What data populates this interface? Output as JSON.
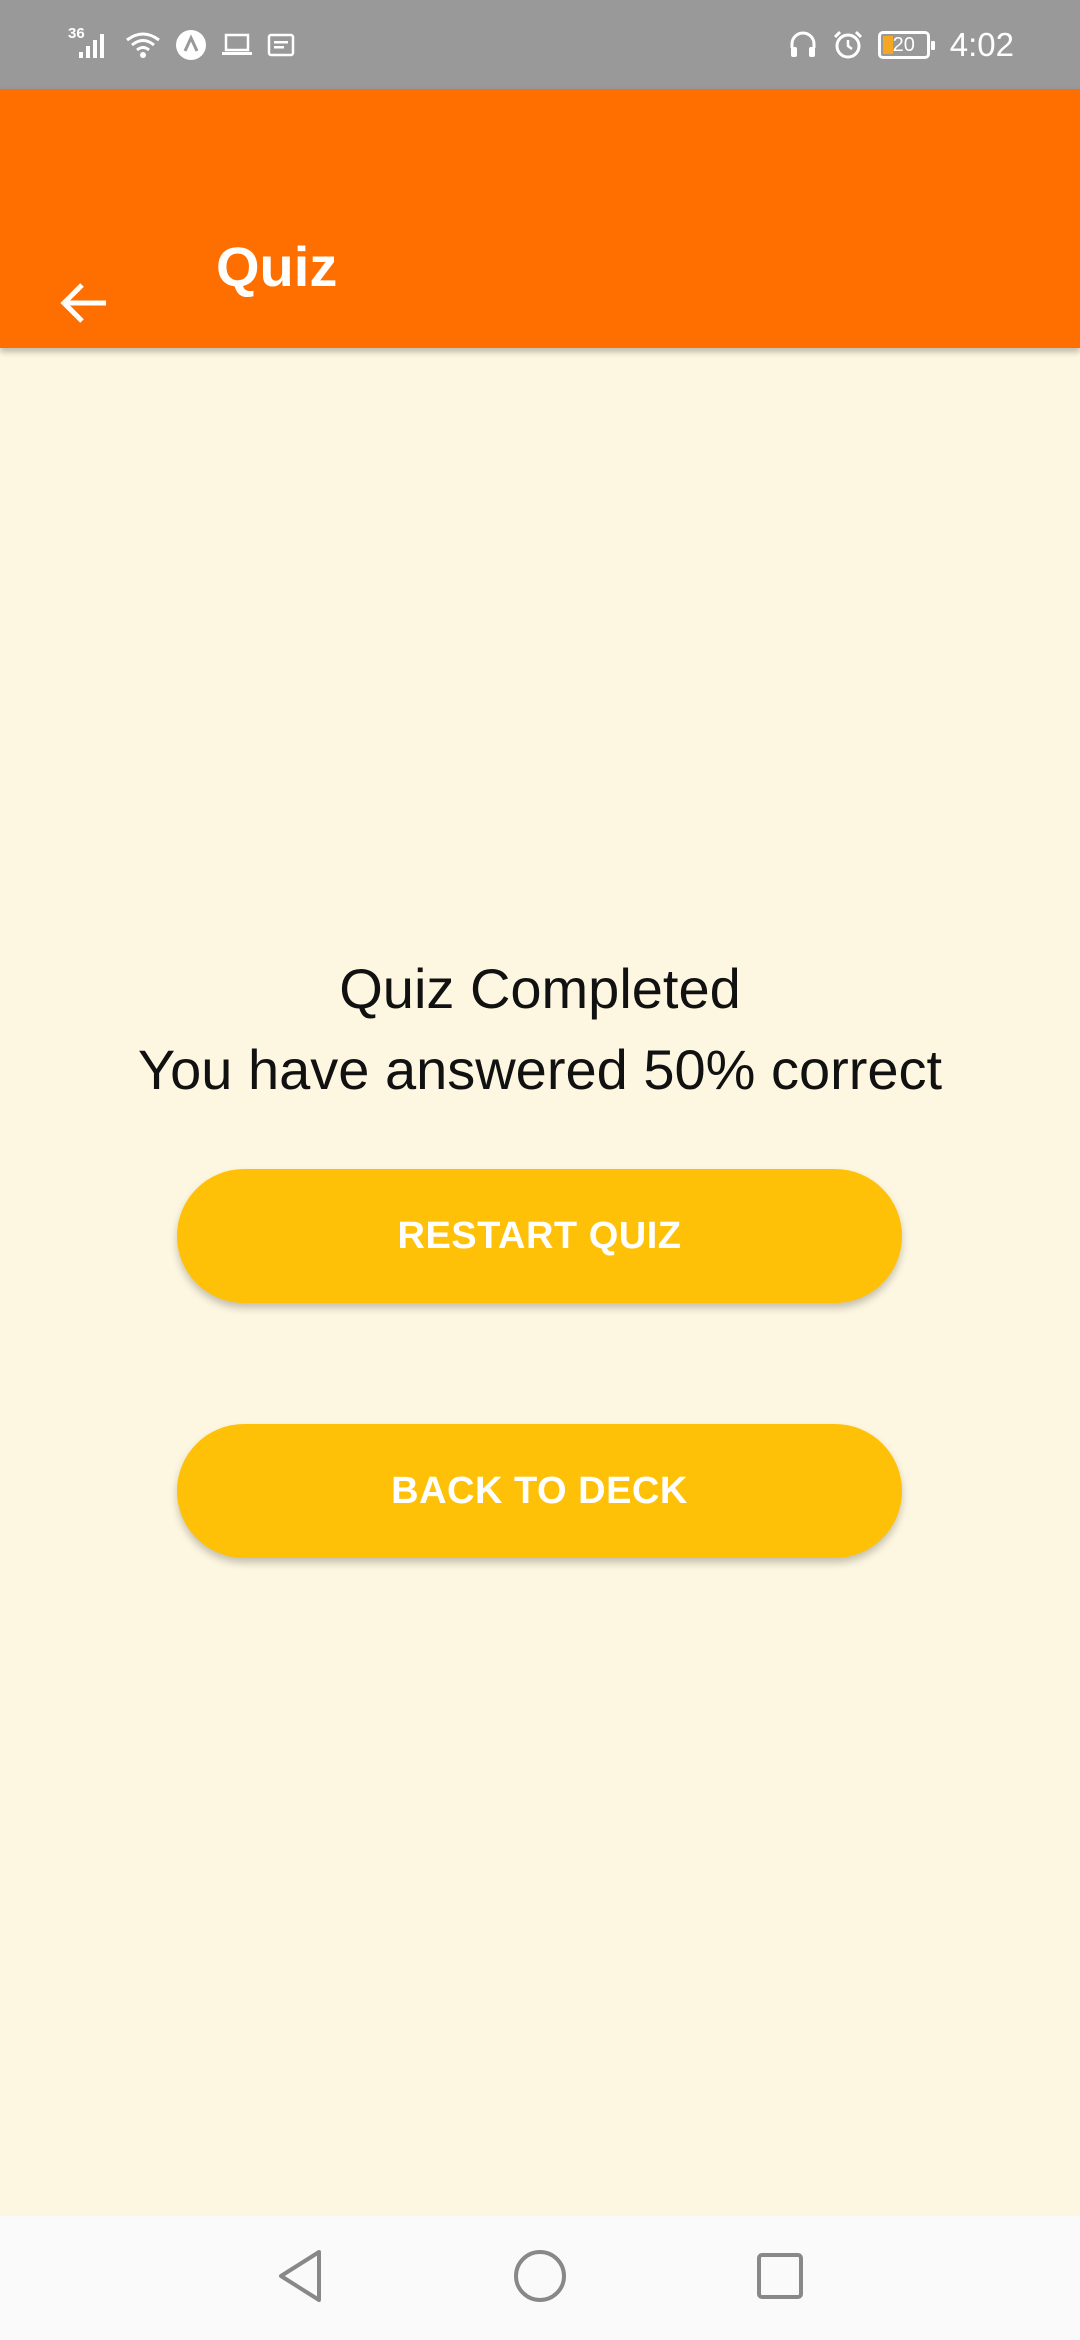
{
  "status_bar": {
    "network_label": "36",
    "icons": [
      "signal-icon",
      "wifi-icon",
      "app-notification-icon",
      "laptop-icon",
      "message-icon"
    ],
    "right_icons": [
      "headset-icon",
      "alarm-icon"
    ],
    "battery_level": "20",
    "time": "4:02"
  },
  "app_bar": {
    "title": "Quiz",
    "back_icon": "arrow-left-icon",
    "color": "#FF6F00"
  },
  "quiz_result": {
    "title": "Quiz Completed",
    "message": "You have answered 50% correct",
    "score_percent": 50
  },
  "actions": {
    "restart_label": "RESTART QUIZ",
    "back_to_deck_label": "BACK TO DECK",
    "button_color": "#FFC107"
  },
  "nav_bar": {
    "icons": [
      "nav-back-icon",
      "nav-home-icon",
      "nav-recents-icon"
    ]
  },
  "colors": {
    "background": "#FDF7E1",
    "status_bar": "#999999"
  }
}
